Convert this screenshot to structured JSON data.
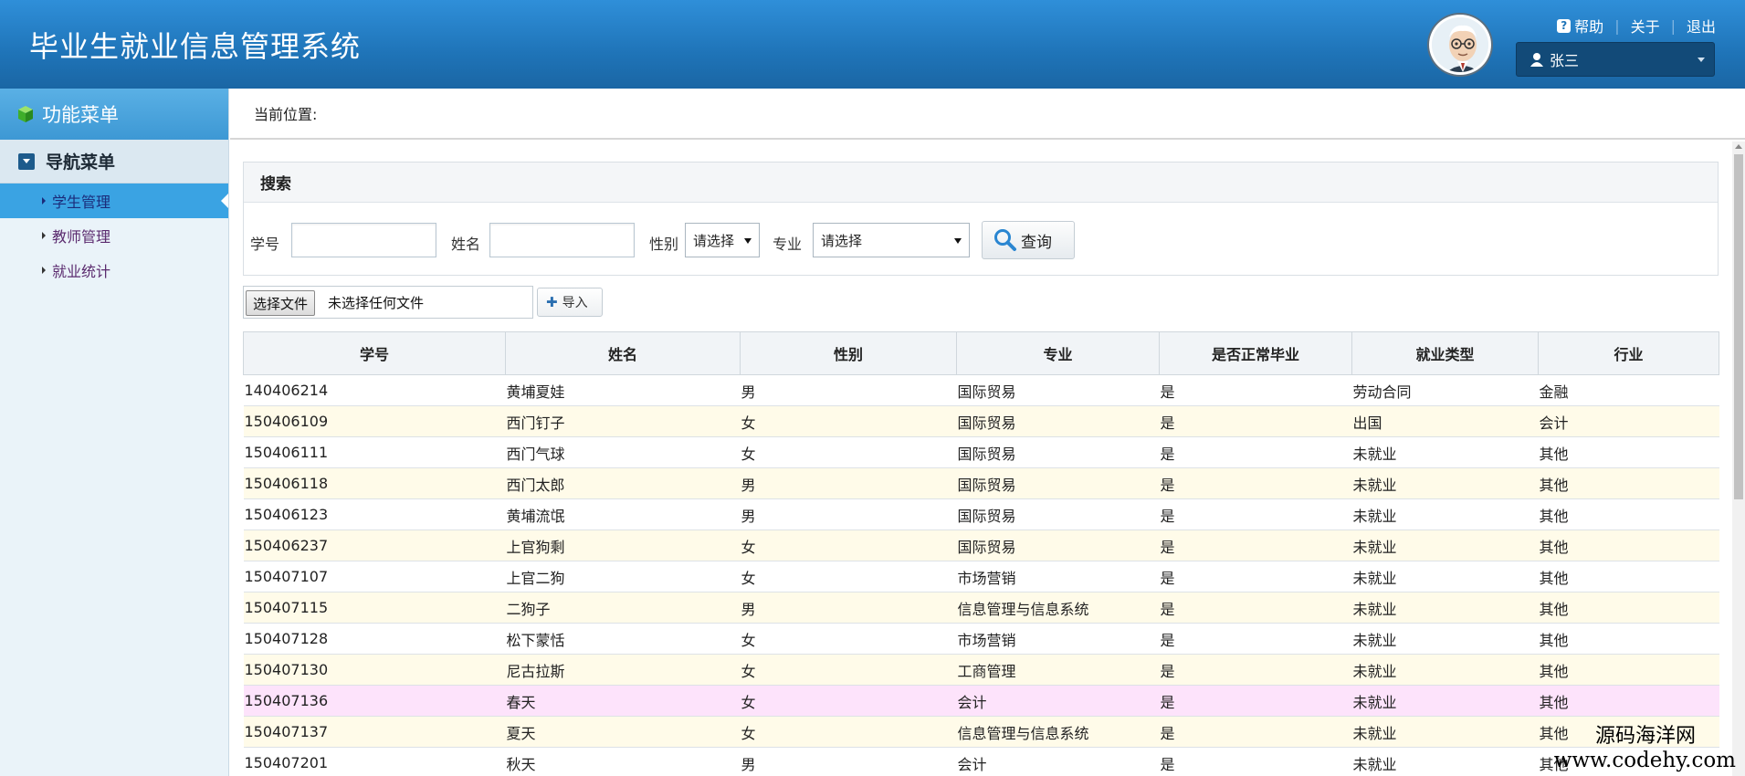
{
  "header": {
    "title": "毕业生就业信息管理系统",
    "links": {
      "help": "帮助",
      "about": "关于",
      "logout": "退出"
    },
    "user": "张三"
  },
  "sidebar": {
    "menu_title": "功能菜单",
    "nav_title": "导航菜单",
    "items": [
      {
        "label": "学生管理",
        "active": true
      },
      {
        "label": "教师管理",
        "active": false
      },
      {
        "label": "就业统计",
        "active": false
      }
    ]
  },
  "breadcrumb": {
    "label": "当前位置:"
  },
  "search": {
    "title": "搜索",
    "student_id_label": "学号",
    "name_label": "姓名",
    "gender_label": "性别",
    "gender_value": "请选择",
    "major_label": "专业",
    "major_value": "请选择",
    "query_button": "查询"
  },
  "file": {
    "choose_button": "选择文件",
    "status": "未选择任何文件",
    "import_button": "导入"
  },
  "table": {
    "columns": [
      "学号",
      "姓名",
      "性别",
      "专业",
      "是否正常毕业",
      "就业类型",
      "行业"
    ],
    "rows": [
      [
        "140406214",
        "黄埔夏娃",
        "男",
        "国际贸易",
        "是",
        "劳动合同",
        "金融"
      ],
      [
        "150406109",
        "西门钉子",
        "女",
        "国际贸易",
        "是",
        "出国",
        "会计"
      ],
      [
        "150406111",
        "西门气球",
        "女",
        "国际贸易",
        "是",
        "未就业",
        "其他"
      ],
      [
        "150406118",
        "西门太郎",
        "男",
        "国际贸易",
        "是",
        "未就业",
        "其他"
      ],
      [
        "150406123",
        "黄埔流氓",
        "男",
        "国际贸易",
        "是",
        "未就业",
        "其他"
      ],
      [
        "150406237",
        "上官狗剩",
        "女",
        "国际贸易",
        "是",
        "未就业",
        "其他"
      ],
      [
        "150407107",
        "上官二狗",
        "女",
        "市场营销",
        "是",
        "未就业",
        "其他"
      ],
      [
        "150407115",
        "二狗子",
        "男",
        "信息管理与信息系统",
        "是",
        "未就业",
        "其他"
      ],
      [
        "150407128",
        "松下蒙恬",
        "女",
        "市场营销",
        "是",
        "未就业",
        "其他"
      ],
      [
        "150407130",
        "尼古拉斯",
        "女",
        "工商管理",
        "是",
        "未就业",
        "其他"
      ],
      [
        "150407136",
        "春天",
        "女",
        "会计",
        "是",
        "未就业",
        "其他"
      ],
      [
        "150407137",
        "夏天",
        "女",
        "信息管理与信息系统",
        "是",
        "未就业",
        "其他"
      ],
      [
        "150407201",
        "秋天",
        "男",
        "会计",
        "是",
        "未就业",
        "其他"
      ]
    ]
  },
  "watermark": {
    "line1": "源码海洋网",
    "line2": "www.codehy.com"
  }
}
